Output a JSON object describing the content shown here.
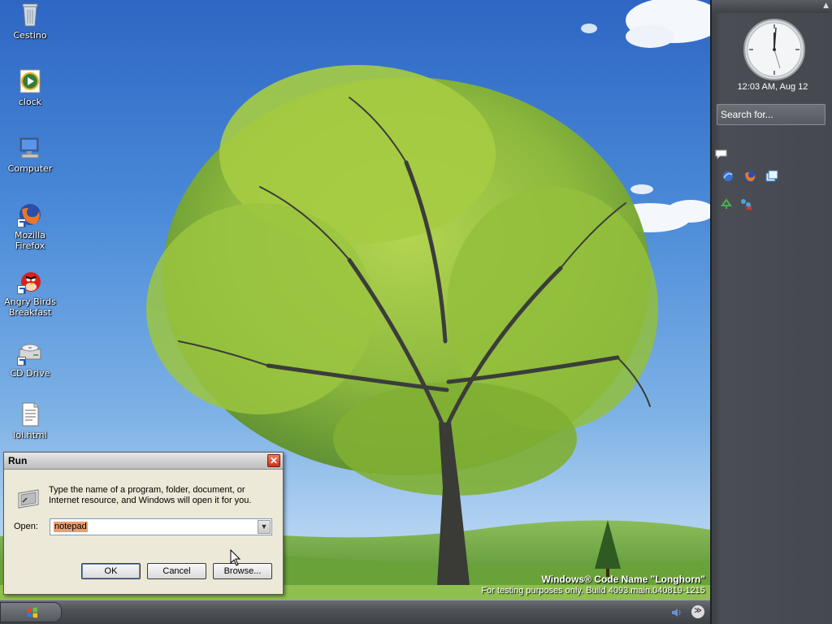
{
  "desktop": {
    "icons": [
      {
        "label": "Cestino",
        "icon": "recycle-bin-icon"
      },
      {
        "label": "clock",
        "icon": "media-clock-icon"
      },
      {
        "label": "Computer",
        "icon": "computer-icon"
      },
      {
        "label": "Mozilla Firefox",
        "icon": "firefox-icon",
        "shortcut": true
      },
      {
        "label": "Angry Birds Breakfast",
        "icon": "angry-birds-icon",
        "shortcut": true
      },
      {
        "label": "CD Drive",
        "icon": "cd-drive-icon",
        "shortcut": true
      },
      {
        "label": "lol.html",
        "icon": "html-file-icon"
      }
    ],
    "watermark": {
      "title": "Windows® Code Name \"Longhorn\"",
      "build": "For testing purposes only. Build 4093.main.040819-1215"
    }
  },
  "run_dialog": {
    "title": "Run",
    "close_label": "✕",
    "description": "Type the name of a program, folder, document, or Internet resource, and Windows will open it for you.",
    "open_label": "Open:",
    "open_value": "notepad",
    "ok_label": "OK",
    "cancel_label": "Cancel",
    "browse_label": "Browse..."
  },
  "sidebar": {
    "clock_text": "12:03 AM, Aug 12",
    "search_placeholder": "Search for...",
    "quick_launch": [
      "network-icon",
      "firefox-icon",
      "window-switcher-icon",
      "recycle-icon",
      "network-disconnected-icon"
    ]
  },
  "taskbar": {
    "start_icon": "windows-flag-icon",
    "tray": [
      "volume-icon",
      "expand-tray-icon"
    ]
  },
  "colors": {
    "sky": "#4a8ad8",
    "sidebar": "#45494f",
    "dialog_bg": "#ece9d8",
    "selection": "#e8a070"
  }
}
